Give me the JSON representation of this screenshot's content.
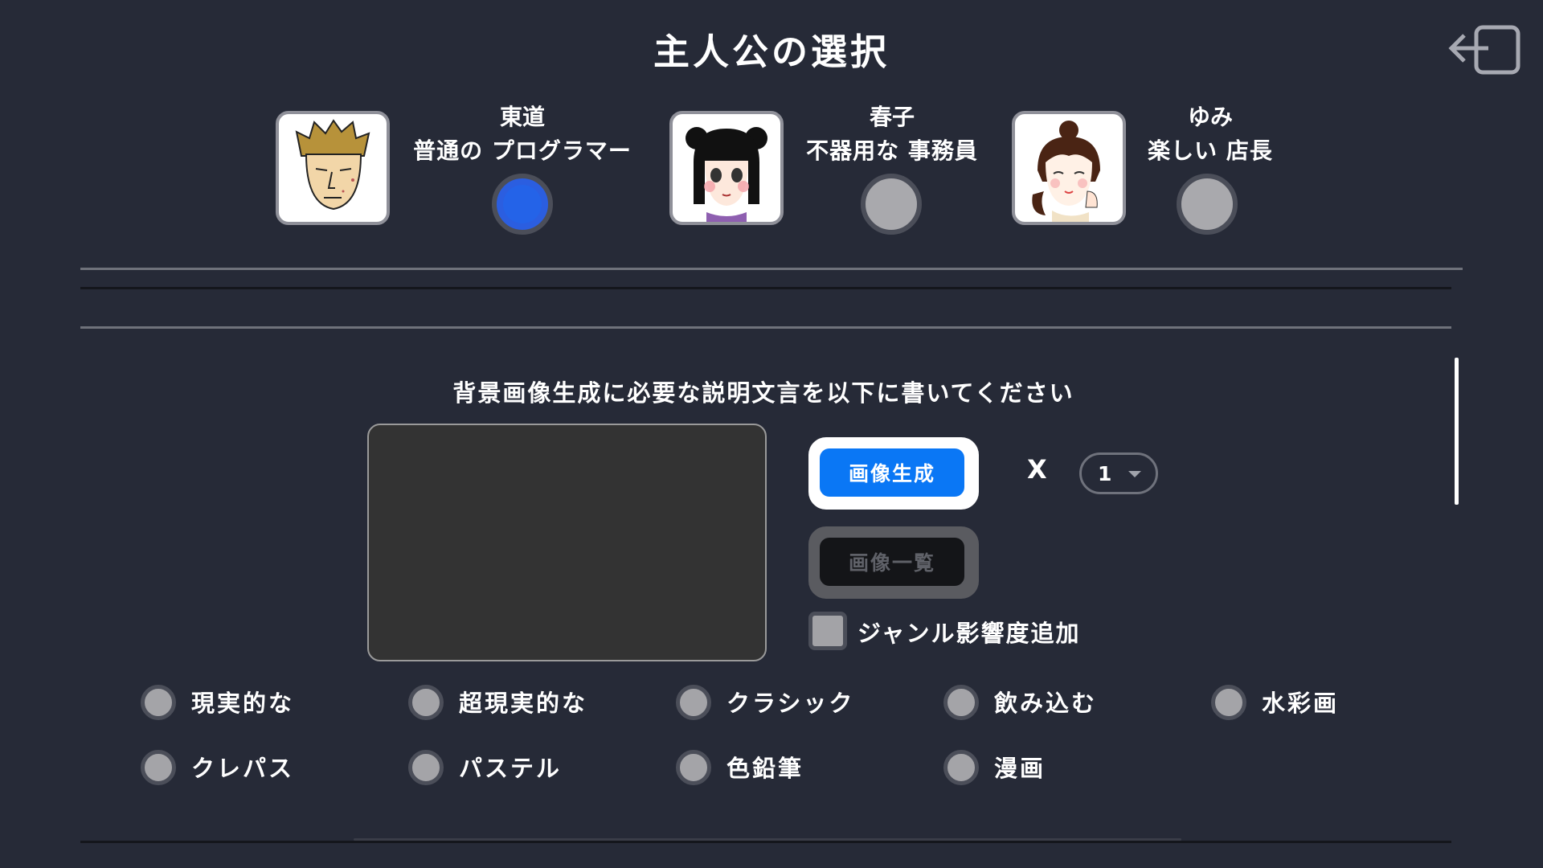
{
  "header": {
    "title": "主人公の選択"
  },
  "characters": [
    {
      "name": "東道",
      "description": "普通の プログラマー",
      "selected": true
    },
    {
      "name": "春子",
      "description": "不器用な 事務員",
      "selected": false
    },
    {
      "name": "ゆみ",
      "description": "楽しい 店長",
      "selected": false
    }
  ],
  "generator": {
    "prompt_label": "背景画像生成に必要な説明文言を以下に書いてください",
    "description_value": "",
    "generate_button": "画像生成",
    "list_button": "画像一覧",
    "multiplier_symbol": "X",
    "count_value": "1",
    "genre_checkbox_label": "ジャンル影響度追加",
    "genre_checked": false
  },
  "styles": [
    {
      "label": "現実的な"
    },
    {
      "label": "超現実的な"
    },
    {
      "label": "クラシック"
    },
    {
      "label": "飲み込む"
    },
    {
      "label": "水彩画"
    },
    {
      "label": "クレパス"
    },
    {
      "label": "パステル"
    },
    {
      "label": "色鉛筆"
    },
    {
      "label": "漫画"
    }
  ],
  "colors": {
    "background": "#262a37",
    "accent_blue": "#0a77f5",
    "selected_radio": "#2463e8"
  }
}
